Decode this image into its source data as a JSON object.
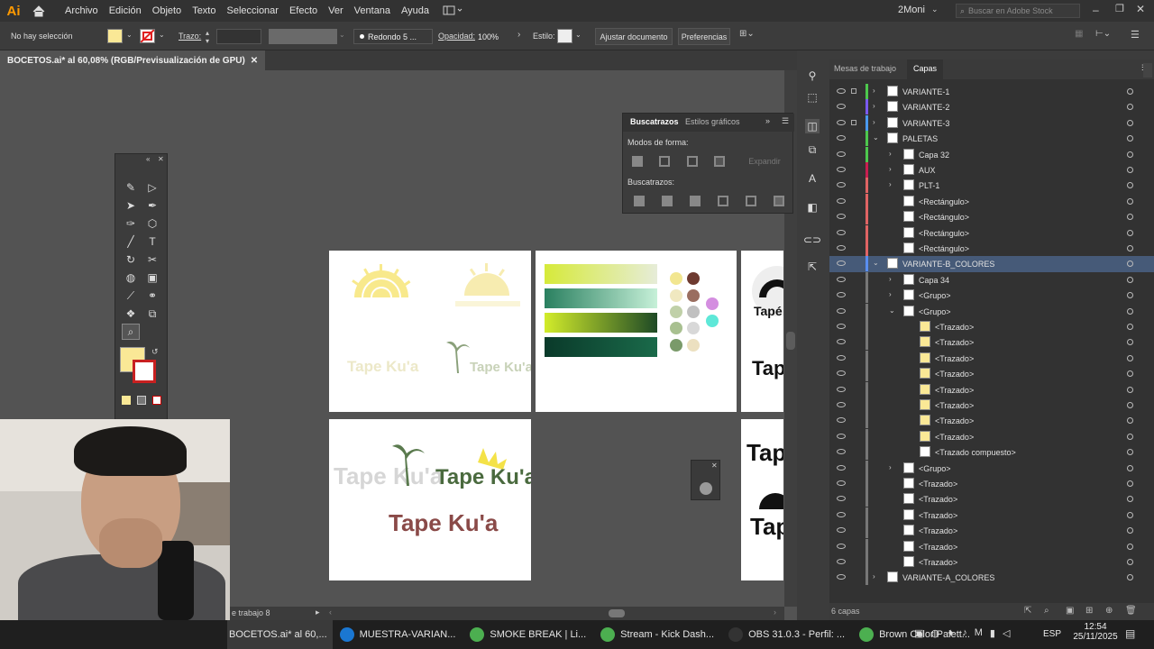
{
  "app": {
    "logo": "Ai"
  },
  "menu": [
    "Archivo",
    "Edición",
    "Objeto",
    "Texto",
    "Seleccionar",
    "Efecto",
    "Ver",
    "Ventana",
    "Ayuda"
  ],
  "workspace": "2Moni",
  "stock_search": "Buscar en Adobe Stock",
  "control": {
    "selection": "No hay selección",
    "stroke_label": "Trazo:",
    "brush": "Redondo 5 ...",
    "opacity_label": "Opacidad:",
    "opacity_value": "100%",
    "style_label": "Estilo:",
    "adjust_doc": "Ajustar documento",
    "prefs": "Preferencias",
    "fill_color": "#fae896"
  },
  "doc_tab": "BOCETOS.ai* al 60,08% (RGB/Previsualización de GPU)",
  "pathfinder": {
    "tab1": "Buscatrazos",
    "tab2": "Estilos gráficos",
    "shape_modes": "Modos de forma:",
    "expand": "Expandir",
    "pathfinders": "Buscatrazos:"
  },
  "layers_panel": {
    "tab1": "Mesas de trabajo",
    "tab2": "Capas",
    "count": "6 capas"
  },
  "layers": [
    {
      "name": "VARIANTE-1",
      "color": "#4dc84d",
      "lock": true,
      "indent": 0,
      "chev": true
    },
    {
      "name": "VARIANTE-2",
      "color": "#7a5af0",
      "lock": false,
      "indent": 0,
      "chev": true
    },
    {
      "name": "VARIANTE-3",
      "color": "#4a9af0",
      "lock": true,
      "indent": 0,
      "chev": true
    },
    {
      "name": "PALETAS",
      "color": "#4dc84d",
      "lock": false,
      "indent": 0,
      "chev": true
    },
    {
      "name": "Capa 32",
      "color": "#4dc84d",
      "lock": false,
      "indent": 1,
      "chev": true
    },
    {
      "name": "AUX",
      "color": "#c81e50",
      "lock": false,
      "indent": 1,
      "chev": true
    },
    {
      "name": "PLT-1",
      "color": "#e06464",
      "lock": false,
      "indent": 1,
      "chev": true
    },
    {
      "name": "<Rectángulo>",
      "color": "#e06464",
      "lock": false,
      "indent": 1,
      "chev": false
    },
    {
      "name": "<Rectángulo>",
      "color": "#e06464",
      "lock": false,
      "indent": 1,
      "chev": false
    },
    {
      "name": "<Rectángulo>",
      "color": "#e06464",
      "lock": false,
      "indent": 1,
      "chev": false
    },
    {
      "name": "<Rectángulo>",
      "color": "#e06464",
      "lock": false,
      "indent": 1,
      "chev": false
    },
    {
      "name": "VARIANTE-B_COLORES",
      "color": "#5a8ef0",
      "lock": false,
      "indent": 0,
      "chev": true,
      "selected": true
    },
    {
      "name": "Capa 34",
      "color": "#777",
      "lock": false,
      "indent": 1,
      "chev": true
    },
    {
      "name": "<Grupo>",
      "color": "#777",
      "lock": false,
      "indent": 1,
      "chev": true
    },
    {
      "name": "<Grupo>",
      "color": "#777",
      "lock": false,
      "indent": 1,
      "chev": true
    },
    {
      "name": "<Trazado>",
      "color": "#777",
      "lock": false,
      "indent": 2,
      "chev": false,
      "yellow": true
    },
    {
      "name": "<Trazado>",
      "color": "#777",
      "lock": false,
      "indent": 2,
      "chev": false,
      "yellow": true
    },
    {
      "name": "<Trazado>",
      "color": "#777",
      "lock": false,
      "indent": 2,
      "chev": false,
      "yellow": true
    },
    {
      "name": "<Trazado>",
      "color": "#777",
      "lock": false,
      "indent": 2,
      "chev": false,
      "yellow": true
    },
    {
      "name": "<Trazado>",
      "color": "#777",
      "lock": false,
      "indent": 2,
      "chev": false,
      "yellow": true
    },
    {
      "name": "<Trazado>",
      "color": "#777",
      "lock": false,
      "indent": 2,
      "chev": false,
      "yellow": true
    },
    {
      "name": "<Trazado>",
      "color": "#777",
      "lock": false,
      "indent": 2,
      "chev": false,
      "yellow": true
    },
    {
      "name": "<Trazado>",
      "color": "#777",
      "lock": false,
      "indent": 2,
      "chev": false,
      "yellow": true
    },
    {
      "name": "<Trazado compuesto>",
      "color": "#777",
      "lock": false,
      "indent": 2,
      "chev": false
    },
    {
      "name": "<Grupo>",
      "color": "#777",
      "lock": false,
      "indent": 1,
      "chev": true
    },
    {
      "name": "<Trazado>",
      "color": "#777",
      "lock": false,
      "indent": 1,
      "chev": false
    },
    {
      "name": "<Trazado>",
      "color": "#777",
      "lock": false,
      "indent": 1,
      "chev": false
    },
    {
      "name": "<Trazado>",
      "color": "#777",
      "lock": false,
      "indent": 1,
      "chev": false
    },
    {
      "name": "<Trazado>",
      "color": "#777",
      "lock": false,
      "indent": 1,
      "chev": false
    },
    {
      "name": "<Trazado>",
      "color": "#777",
      "lock": false,
      "indent": 1,
      "chev": false
    },
    {
      "name": "<Trazado>",
      "color": "#777",
      "lock": false,
      "indent": 1,
      "chev": false
    },
    {
      "name": "VARIANTE-A_COLORES",
      "color": "#777",
      "lock": false,
      "indent": 0,
      "chev": true
    }
  ],
  "artboard_label": "e trabajo 8",
  "artwork": {
    "logo": "Tape Ku'a",
    "partial_1": "Tape",
    "partial_2": "Tapé",
    "partial_3": "Tap"
  },
  "taskbar": [
    {
      "label": "BOCETOS.ai* al 60,...",
      "icon": "#ff9a00"
    },
    {
      "label": "MUESTRA-VARIAN...",
      "icon": "#1a77d2"
    },
    {
      "label": "SMOKE BREAK | Li...",
      "icon": "#4caf50"
    },
    {
      "label": "Stream - Kick Dash...",
      "icon": "#4caf50"
    },
    {
      "label": "OBS 31.0.3 - Perfil: ...",
      "icon": "#333"
    },
    {
      "label": "Brown Color Palett...",
      "icon": "#4caf50"
    }
  ],
  "tray": {
    "lang": "ESP",
    "time": "12:54",
    "date": "25/11/2025"
  }
}
